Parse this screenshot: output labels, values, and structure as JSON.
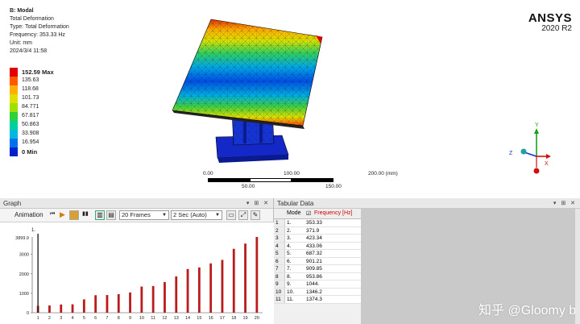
{
  "result_info": {
    "title": "B: Modal",
    "lines": [
      "Total Deformation",
      "Type: Total Deformation",
      "Frequency: 353.33 Hz",
      "Unit: mm",
      "2024/3/4 11:58"
    ]
  },
  "legend": [
    {
      "label": "152.59 Max",
      "color": "#e00000"
    },
    {
      "label": "135.63",
      "color": "#ff5a00"
    },
    {
      "label": "118.68",
      "color": "#ffb000"
    },
    {
      "label": "101.73",
      "color": "#e0e000"
    },
    {
      "label": "84.771",
      "color": "#9ee000"
    },
    {
      "label": "67.817",
      "color": "#2fd13a"
    },
    {
      "label": "50.863",
      "color": "#00d0a0"
    },
    {
      "label": "33.908",
      "color": "#00b8e0"
    },
    {
      "label": "16.954",
      "color": "#0070f0"
    },
    {
      "label": "0 Min",
      "color": "#0020c8"
    }
  ],
  "brand": {
    "name": "ANSYS",
    "version": "2020 R2"
  },
  "scale": {
    "labels": [
      "0.00",
      "100.00",
      "200.00 (mm)",
      "50.00",
      "150.00"
    ]
  },
  "triad": {
    "x": "X",
    "y": "Y",
    "z": "Z"
  },
  "graph": {
    "panel_title": "Graph",
    "panel_controls": "▾ ⊞ ✕",
    "animation_label": "Animation",
    "frames": "20 Frames",
    "duration": "2 Sec (Auto)",
    "mode_num": "1."
  },
  "tabular": {
    "panel_title": "Tabular Data",
    "panel_controls": "▾ ⊞ ✕",
    "col_mode": "Mode",
    "col_freq": "Frequency [Hz]",
    "rows": [
      [
        "1",
        "1.",
        "353.33"
      ],
      [
        "2",
        "2.",
        "371.9"
      ],
      [
        "3",
        "3.",
        "423.34"
      ],
      [
        "4",
        "4.",
        "433.06"
      ],
      [
        "5",
        "5.",
        "687.32"
      ],
      [
        "6",
        "6.",
        "901.21"
      ],
      [
        "7",
        "7.",
        "909.85"
      ],
      [
        "8",
        "8.",
        "953.86"
      ],
      [
        "9",
        "9.",
        "1044."
      ],
      [
        "10",
        "10.",
        "1346.2"
      ],
      [
        "11",
        "11.",
        "1374.3"
      ]
    ]
  },
  "watermark": "知乎 @Gloomy bear",
  "colors": {
    "bar": "#b81c1c",
    "panel_bg": "#f0f0f0",
    "freq_header": "#cc0000"
  },
  "chart_data": {
    "type": "bar",
    "categories": [
      "1",
      "2",
      "3",
      "4",
      "5",
      "6",
      "7",
      "8",
      "9",
      "10",
      "11",
      "12",
      "13",
      "14",
      "15",
      "16",
      "17",
      "18",
      "19",
      "20"
    ],
    "values": [
      353.33,
      371.9,
      423.34,
      433.06,
      687.32,
      901.21,
      909.85,
      953.86,
      1044,
      1346.2,
      1374.3,
      1580,
      1870,
      2250,
      2330,
      2540,
      2720,
      3290,
      3560,
      3899.9
    ],
    "ymax_label": "3899.9",
    "yticks": [
      0,
      1000,
      2000,
      3000
    ],
    "ylim": [
      0,
      3899.9
    ]
  }
}
